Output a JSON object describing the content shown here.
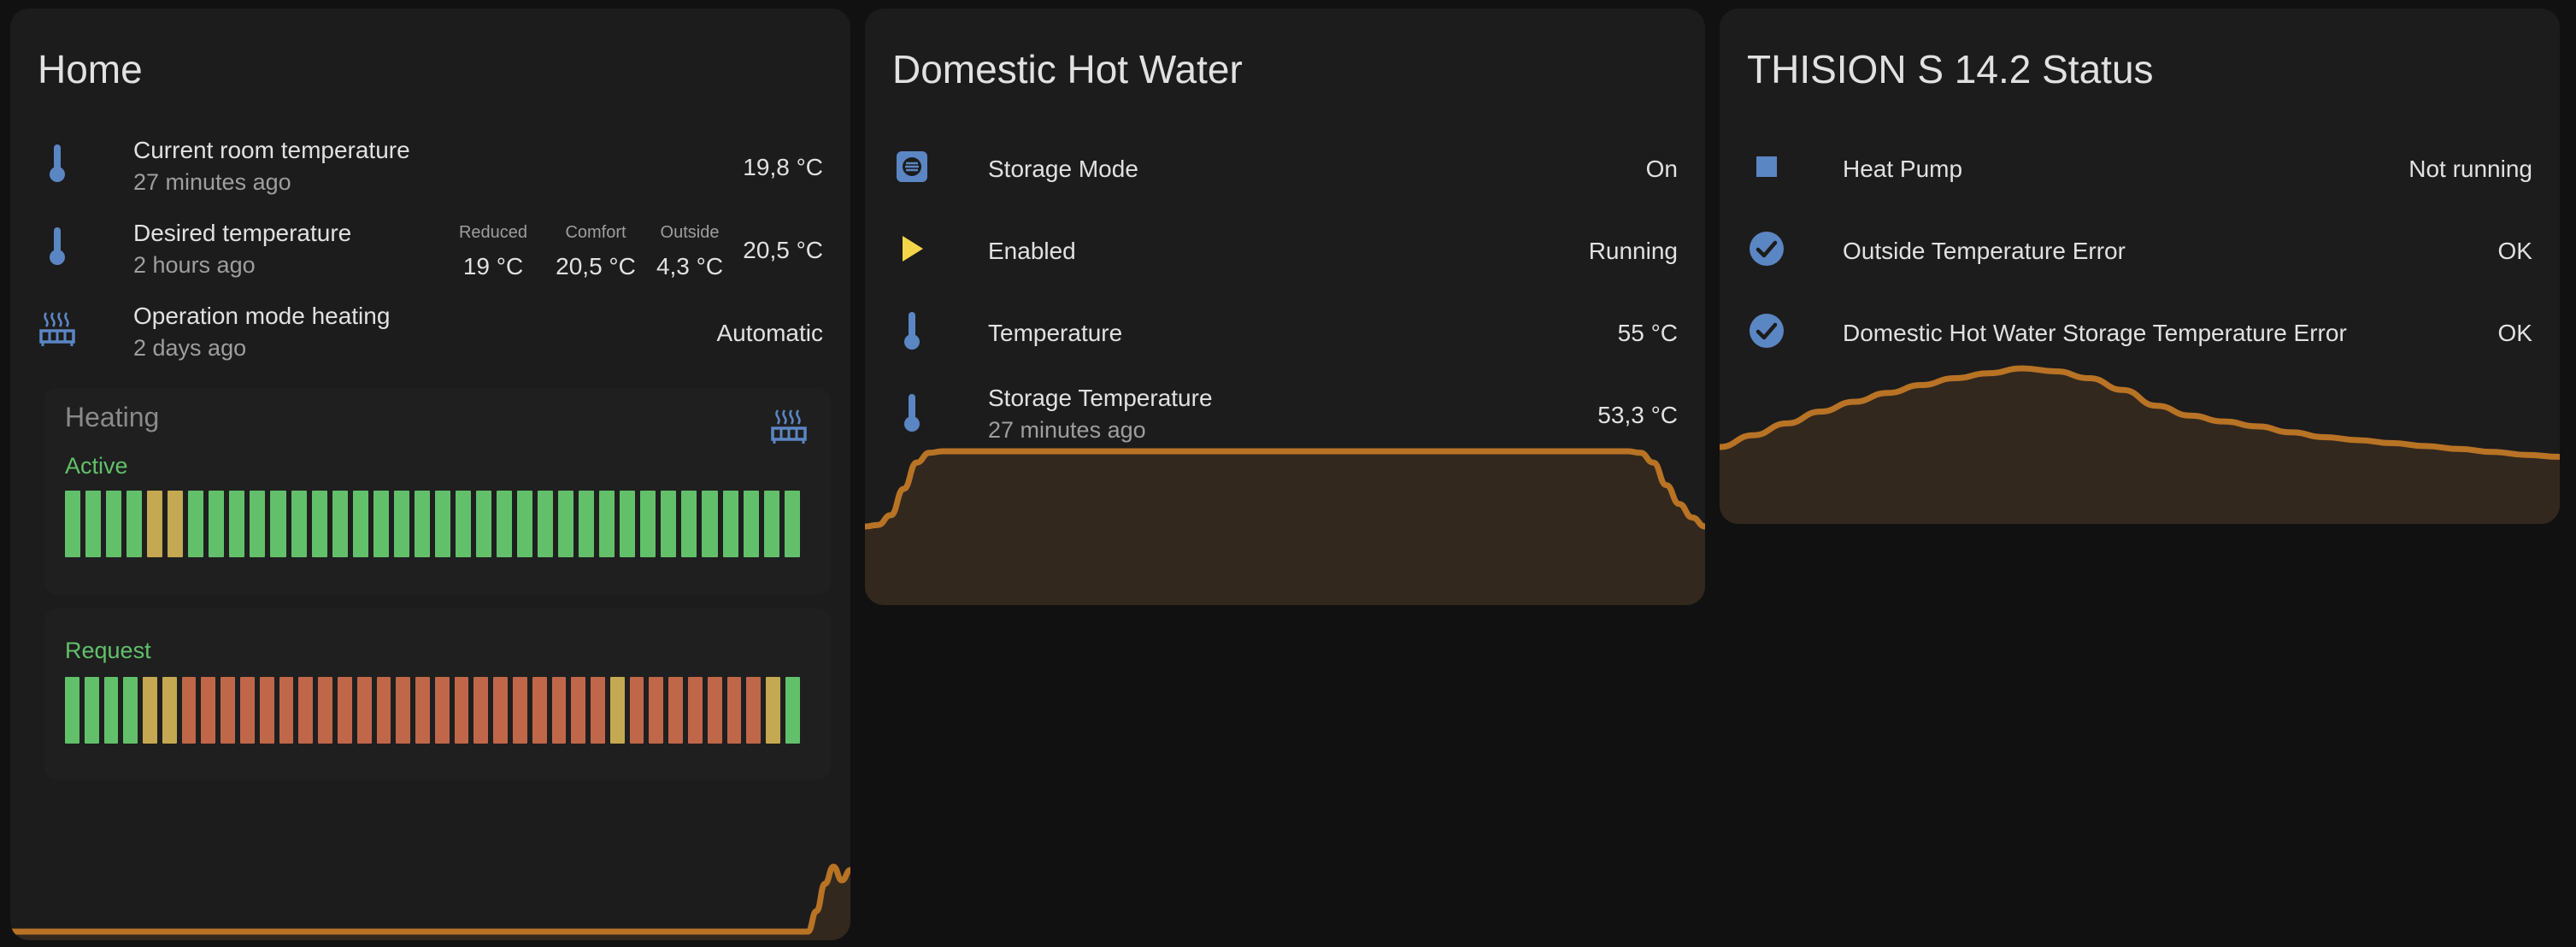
{
  "colors": {
    "blue_icon": "#5b86c4",
    "yellow_icon": "#f3d54a",
    "ok_icon": "#5b86c4",
    "graph_line": "#b87325",
    "graph_fill": "#33281e",
    "bar_green": "#62c06b",
    "bar_yellow": "#c4a852",
    "bar_red": "#c0674a"
  },
  "home": {
    "title": "Home",
    "rows": [
      {
        "icon": "thermometer-icon",
        "name": "Current room temperature",
        "secondary": "27 minutes ago",
        "value": "19,8 °C"
      },
      {
        "icon": "thermometer-icon",
        "name": "Desired temperature",
        "secondary": "2 hours ago",
        "value": "20,5 °C",
        "attributes": [
          {
            "label": "Reduced",
            "value": "19 °C"
          },
          {
            "label": "Comfort",
            "value": "20,5 °C"
          },
          {
            "label": "Outside",
            "value": "4,3 °C"
          }
        ]
      },
      {
        "icon": "radiator-icon",
        "name": "Operation mode heating",
        "secondary": "2 days ago",
        "value": "Automatic"
      }
    ],
    "heating_card": {
      "title": "Heating",
      "icon": "radiator-icon",
      "status": "Active",
      "history": [
        "green",
        "green",
        "green",
        "green",
        "yellow",
        "yellow",
        "green",
        "green",
        "green",
        "green",
        "green",
        "green",
        "green",
        "green",
        "green",
        "green",
        "green",
        "green",
        "green",
        "green",
        "green",
        "green",
        "green",
        "green",
        "green",
        "green",
        "green",
        "green",
        "green",
        "green",
        "green",
        "green",
        "green",
        "green",
        "green",
        "green"
      ]
    },
    "request_card": {
      "status": "Request",
      "history": [
        "green",
        "green",
        "green",
        "green",
        "yellow",
        "yellow",
        "red",
        "red",
        "red",
        "red",
        "red",
        "red",
        "red",
        "red",
        "red",
        "red",
        "red",
        "red",
        "red",
        "red",
        "red",
        "red",
        "red",
        "red",
        "red",
        "red",
        "red",
        "red",
        "yellow",
        "red",
        "red",
        "red",
        "red",
        "red",
        "red",
        "red",
        "yellow",
        "green"
      ]
    },
    "sparkline": {
      "values": [
        0,
        0,
        0,
        0,
        0,
        0,
        0,
        0,
        0,
        0,
        0,
        0,
        0,
        0,
        0,
        0,
        0,
        0,
        0,
        0,
        0,
        0,
        0,
        0,
        0,
        0,
        0,
        0,
        0,
        0,
        0,
        0,
        0,
        0,
        0,
        0,
        0,
        0,
        0,
        0,
        0,
        0,
        0,
        0,
        0,
        0,
        0,
        0,
        0,
        0,
        0,
        0,
        0,
        0,
        0,
        0,
        0,
        0,
        0,
        0,
        0,
        0,
        0,
        0,
        0,
        0,
        0,
        0,
        0,
        0,
        0,
        0,
        0,
        0,
        0,
        0,
        0,
        0,
        0,
        0,
        0,
        0,
        0,
        0,
        0,
        0,
        0,
        0,
        0,
        0,
        0,
        0,
        0,
        0,
        0,
        0.3,
        0.7,
        0.95,
        0.75,
        0.9
      ]
    }
  },
  "dhw": {
    "title": "Domestic Hot Water",
    "rows": [
      {
        "icon": "water-boiler-icon",
        "name": "Storage Mode",
        "secondary": "",
        "value": "On"
      },
      {
        "icon": "play-icon",
        "name": "Enabled",
        "secondary": "",
        "value": "Running"
      },
      {
        "icon": "thermometer-icon",
        "name": "Temperature",
        "secondary": "",
        "value": "55 °C"
      },
      {
        "icon": "thermometer-icon",
        "name": "Storage Temperature",
        "secondary": "27 minutes ago",
        "value": "53,3 °C"
      }
    ],
    "sparkline": {
      "values": [
        0.0,
        0.02,
        0.15,
        0.5,
        0.85,
        0.98,
        1,
        1,
        1,
        1,
        1,
        1,
        1,
        1,
        1,
        1,
        1,
        1,
        1,
        1,
        1,
        1,
        1,
        1,
        1,
        1,
        1,
        1,
        1,
        1,
        1,
        1,
        1,
        1,
        1,
        1,
        1,
        1,
        1,
        1,
        1,
        1,
        1,
        1,
        1,
        1,
        1,
        1,
        1,
        1,
        1,
        1,
        1,
        1,
        1,
        1,
        1,
        1,
        1,
        1,
        0.98,
        0.85,
        0.55,
        0.3,
        0.12,
        0.0
      ]
    }
  },
  "status": {
    "title": "THISION S 14.2 Status",
    "rows": [
      {
        "icon": "stop-square-icon",
        "name": "Heat Pump",
        "secondary": "",
        "value": "Not running"
      },
      {
        "icon": "check-circle-icon",
        "name": "Outside Temperature Error",
        "secondary": "",
        "value": "OK"
      },
      {
        "icon": "check-circle-icon",
        "name": "Domestic Hot Water Storage Temperature Error",
        "secondary": "",
        "value": "OK"
      }
    ],
    "sparkline": {
      "values": [
        0.2,
        0.32,
        0.44,
        0.56,
        0.66,
        0.75,
        0.83,
        0.9,
        0.95,
        1,
        0.97,
        0.9,
        0.78,
        0.62,
        0.52,
        0.46,
        0.41,
        0.35,
        0.3,
        0.27,
        0.24,
        0.21,
        0.18,
        0.15,
        0.12,
        0.1
      ]
    }
  }
}
